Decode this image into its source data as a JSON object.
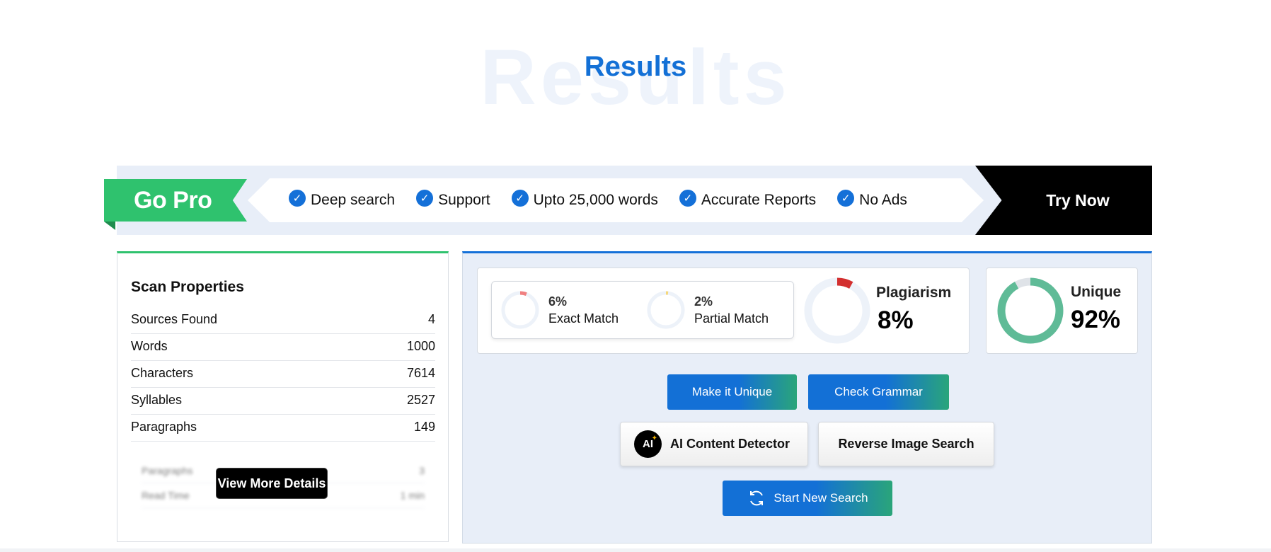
{
  "heading": {
    "watermark": "Results",
    "title": "Results"
  },
  "promo": {
    "badge": "Go Pro",
    "features": [
      "Deep search",
      "Support",
      "Upto 25,000 words",
      "Accurate Reports",
      "No Ads"
    ],
    "cta": "Try Now"
  },
  "scan": {
    "title": "Scan Properties",
    "rows": [
      {
        "label": "Sources Found",
        "value": "4"
      },
      {
        "label": "Words",
        "value": "1000"
      },
      {
        "label": "Characters",
        "value": "7614"
      },
      {
        "label": "Syllables",
        "value": "2527"
      },
      {
        "label": "Paragraphs",
        "value": "149"
      }
    ],
    "blurred_rows": [
      {
        "label": "Paragraphs",
        "value": "3"
      },
      {
        "label": "Read Time",
        "value": "1 min"
      }
    ],
    "more_button": "View More Details"
  },
  "results": {
    "exact": {
      "pct": "6%",
      "label": "Exact Match",
      "fraction": 0.06,
      "color": "#f08080"
    },
    "partial": {
      "pct": "2%",
      "label": "Partial Match",
      "fraction": 0.02,
      "color": "#f5d77a"
    },
    "plagiarism": {
      "label": "Plagiarism",
      "value": "8%",
      "fraction": 0.08,
      "color": "#d32f2f"
    },
    "unique": {
      "label": "Unique",
      "value": "92%",
      "fraction": 0.92,
      "color": "#5fbb97"
    },
    "buttons": {
      "make_unique": "Make it Unique",
      "check_grammar": "Check Grammar",
      "ai_detector": "AI Content Detector",
      "ai_icon": "AI",
      "reverse_image": "Reverse Image Search",
      "new_search": "Start New Search"
    }
  }
}
